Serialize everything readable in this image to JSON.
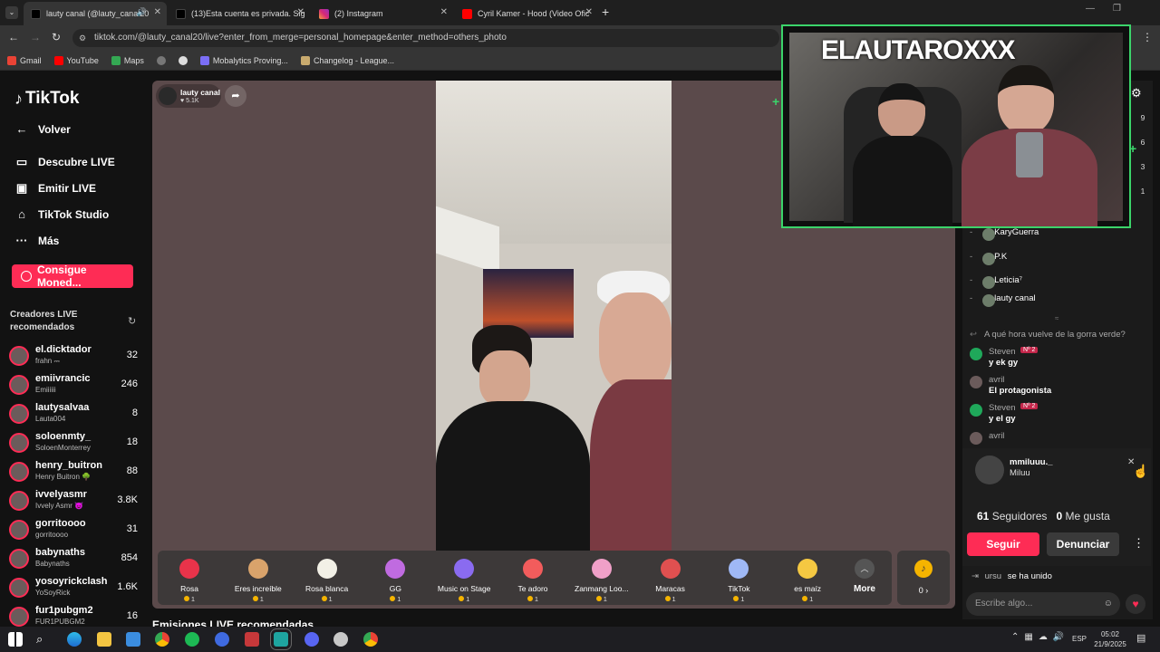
{
  "browser": {
    "tabs": [
      {
        "title": "lauty canal (@lauty_canal20"
      },
      {
        "title": "(13)Esta cuenta es privada. Sig"
      },
      {
        "title": "(2) Instagram"
      },
      {
        "title": "Cyril Kamer - Hood (Video Ofic"
      }
    ],
    "url": "tiktok.com/@lauty_canal20/live?enter_from_merge=personal_homepage&enter_method=others_photo",
    "bookmarks": [
      "Gmail",
      "YouTube",
      "Maps",
      "Mobalytics Proving...",
      "Changelog - League..."
    ]
  },
  "sidebar": {
    "logo": "TikTok",
    "nav": [
      {
        "label": "Volver",
        "icon": "back-arrow-icon"
      },
      {
        "label": "Descubre LIVE",
        "icon": "live-tv-icon"
      },
      {
        "label": "Emitir LIVE",
        "icon": "camera-icon"
      },
      {
        "label": "TikTok Studio",
        "icon": "home-icon"
      },
      {
        "label": "Más",
        "icon": "more-icon"
      }
    ],
    "coins_button": "Consigue Moned...",
    "creators_title": "Creadores LIVE recomendados",
    "creators": [
      {
        "name": "el.dicktador",
        "sub": "frahn ⎓",
        "count": "32"
      },
      {
        "name": "emiivrancic",
        "sub": "Emiiiiii",
        "count": "246"
      },
      {
        "name": "lautysalvaa",
        "sub": "Lauta004",
        "count": "8"
      },
      {
        "name": "soloenmty_",
        "sub": "SoloenMonterrey",
        "count": "18"
      },
      {
        "name": "henry_buitron",
        "sub": "Henry Buitron 🌳",
        "count": "88"
      },
      {
        "name": "ivvelyasmr",
        "sub": "Ivvely Asmr 😈",
        "count": "3.8K"
      },
      {
        "name": "gorritoooo",
        "sub": "gorritoooo",
        "count": "31"
      },
      {
        "name": "babynaths",
        "sub": "Babynaths",
        "count": "854"
      },
      {
        "name": "yosoyrickclash",
        "sub": "YoSoyRick",
        "count": "1.6K"
      },
      {
        "name": "fur1pubgm2",
        "sub": "FUR1PUBGM2",
        "count": "16"
      }
    ]
  },
  "stream": {
    "host_name": "lauty canal",
    "likes": "5.1K",
    "recommended_title": "Emisiones LIVE recomendadas"
  },
  "gifts": [
    {
      "name": "Rosa",
      "price": "1",
      "color": "#e8334a"
    },
    {
      "name": "Eres increíble",
      "price": "1",
      "color": "#d9a36b"
    },
    {
      "name": "Rosa blanca",
      "price": "1",
      "color": "#f2f0e6"
    },
    {
      "name": "GG",
      "price": "1",
      "color": "#c06be0"
    },
    {
      "name": "Music on Stage",
      "price": "1",
      "color": "#8a6bf0"
    },
    {
      "name": "Te adoro",
      "price": "1",
      "color": "#f25c5c"
    },
    {
      "name": "Zanmang Loo...",
      "price": "1",
      "color": "#f0a0c8"
    },
    {
      "name": "Maracas",
      "price": "1",
      "color": "#e05050"
    },
    {
      "name": "TikTok",
      "price": "1",
      "color": "#9fb8f5"
    },
    {
      "name": "es maíz",
      "price": "1",
      "color": "#f5c842"
    }
  ],
  "gift_more": "More",
  "reward_count": "0 ›",
  "viewers": [
    {
      "name": "KaryGuerra"
    },
    {
      "name": "P.K"
    },
    {
      "name": "Leticia⁷"
    },
    {
      "name": "lauty canal"
    }
  ],
  "chat": [
    {
      "user": "",
      "text": "A qué hora vuelve de la gorra verde?"
    },
    {
      "user": "Steven",
      "badge": "Nº 2",
      "text": "y ek gy"
    },
    {
      "user": "avril",
      "text": "El protagonista"
    },
    {
      "user": "Steven",
      "badge": "Nº 2",
      "text": "y el gy"
    },
    {
      "user": "avril",
      "text": ""
    }
  ],
  "profile_card": {
    "handle": "mmiluuu._",
    "name": "Miluu",
    "followers": "61",
    "followers_label": "Seguidores",
    "likes": "0",
    "likes_label": "Me gusta",
    "follow_button": "Seguir",
    "report_button": "Denunciar"
  },
  "join_notice": {
    "user": "ursu",
    "text": "se ha unido"
  },
  "comment_placeholder": "Escribe algo...",
  "pip": {
    "overlay_text": "ELAUTAROXXX"
  },
  "side_numbers": [
    "9",
    "6",
    "3",
    "1"
  ],
  "taskbar": {
    "lang": "ESP",
    "time": "05:02",
    "date": "21/9/2025"
  },
  "colors": {
    "brand": "#fe2c55",
    "pip_border": "#3bd46a"
  }
}
